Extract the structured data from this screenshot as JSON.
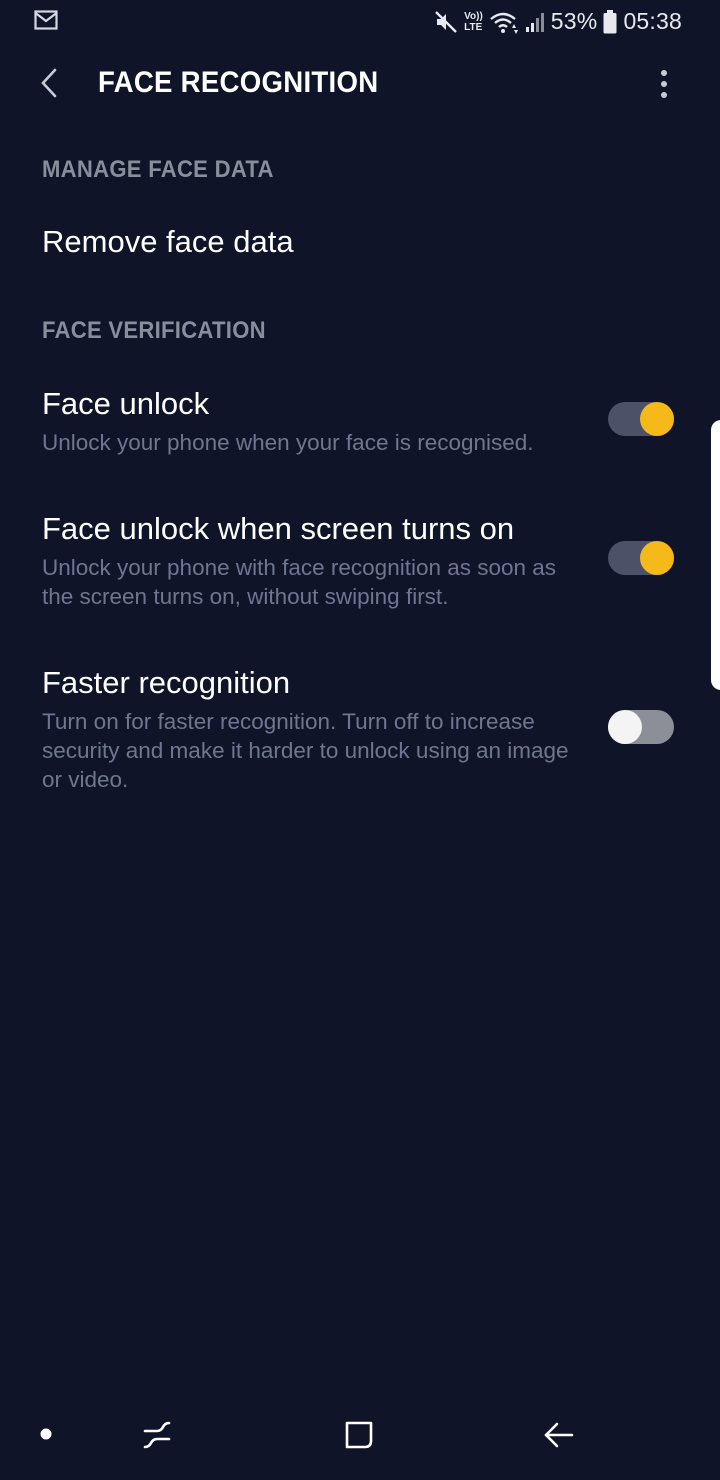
{
  "status_bar": {
    "battery_percent": "53%",
    "time": "05:38",
    "volte_label_top": "Vo))",
    "volte_label_bottom": "LTE",
    "icons": [
      "mail-icon",
      "mute-icon",
      "volte-icon",
      "wifi-icon",
      "signal-icon",
      "battery-icon"
    ]
  },
  "app_bar": {
    "title": "FACE RECOGNITION",
    "back_icon": "chevron-left-icon",
    "more_icon": "more-vertical-icon"
  },
  "sections": [
    {
      "header": "MANAGE FACE DATA",
      "items": [
        {
          "title": "Remove face data"
        }
      ]
    },
    {
      "header": "FACE VERIFICATION",
      "items": [
        {
          "title": "Face unlock",
          "subtitle": "Unlock your phone when your face is recognised.",
          "toggle_on": true
        },
        {
          "title": "Face unlock when screen turns on",
          "subtitle": "Unlock your phone with face recognition as soon as the screen turns on, without swiping first.",
          "toggle_on": true
        },
        {
          "title": "Faster recognition",
          "subtitle": "Turn on for faster recognition. Turn off to increase security and make it harder to unlock using an image or video.",
          "toggle_on": false
        }
      ]
    }
  ],
  "colors": {
    "background": "#0f1428",
    "accent": "#f6b91a",
    "section_header": "#8a8e9c",
    "subtitle": "#6f7691"
  },
  "nav_bar": {
    "icons": [
      "dot-icon",
      "recent-apps-icon",
      "home-icon",
      "back-arrow-icon"
    ]
  }
}
